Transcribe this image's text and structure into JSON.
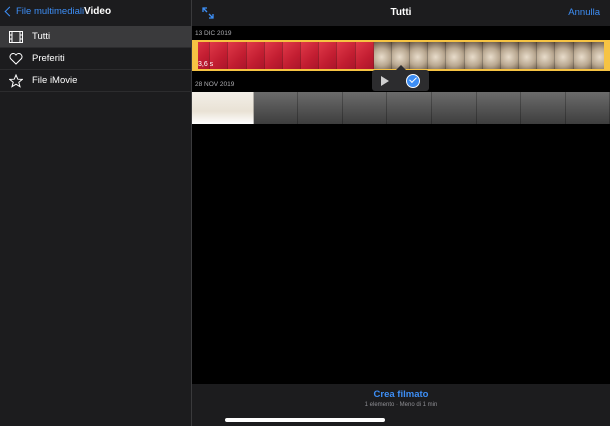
{
  "sidebar": {
    "back_label": "File multimediali",
    "title": "Video",
    "items": [
      {
        "label": "Tutti",
        "icon": "film-icon",
        "active": true
      },
      {
        "label": "Preferiti",
        "icon": "heart-icon",
        "active": false
      },
      {
        "label": "File iMovie",
        "icon": "star-icon",
        "active": false
      }
    ]
  },
  "main": {
    "title": "Tutti",
    "cancel_label": "Annulla",
    "groups": [
      {
        "date": "13 DIC 2019",
        "clip_duration": "3,6 s",
        "selected": true
      },
      {
        "date": "28 NOV 2019",
        "selected": false
      }
    ]
  },
  "bottom": {
    "action_label": "Crea filmato",
    "subtitle": "1 elemento · Meno di 1 min"
  },
  "colors": {
    "accent": "#3d8ef5",
    "selection": "#f6c343"
  }
}
